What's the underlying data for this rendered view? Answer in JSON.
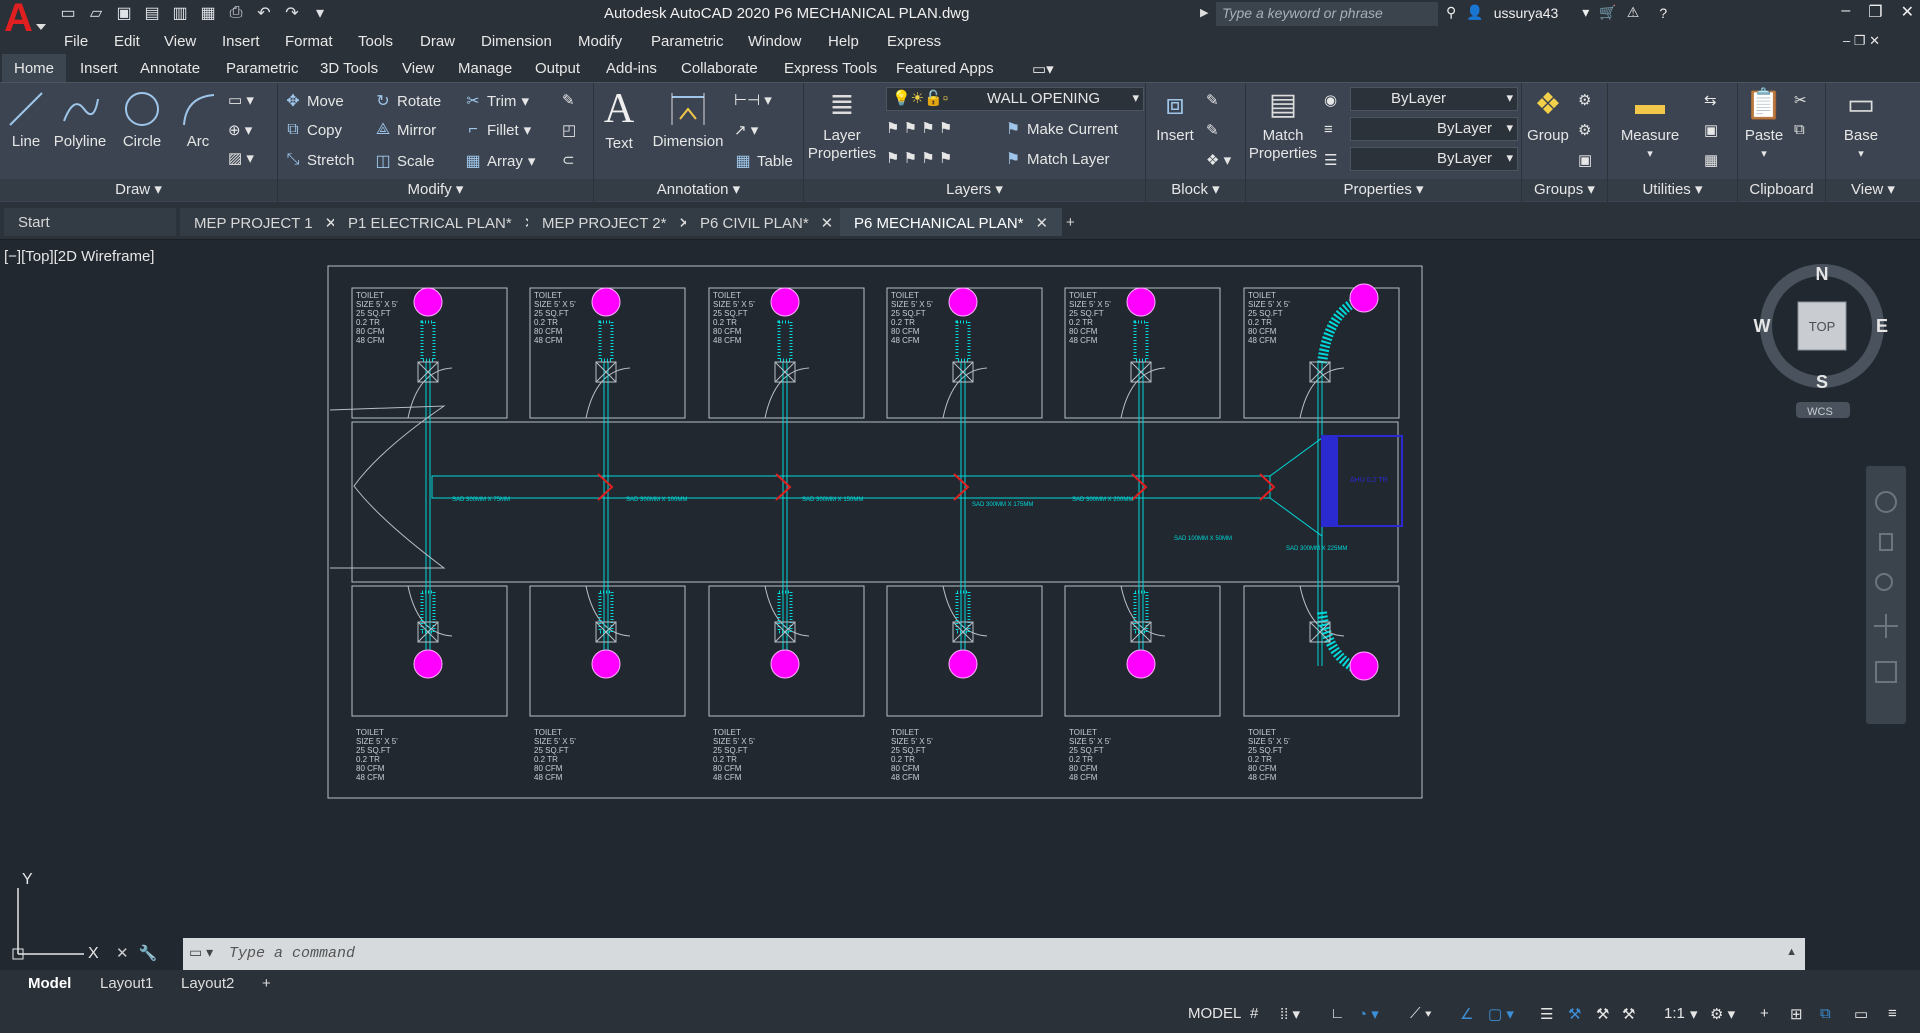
{
  "app": {
    "title": "Autodesk AutoCAD 2020    P6 MECHANICAL PLAN.dwg",
    "search_placeholder": "Type a keyword or phrase",
    "user": "ussurya43"
  },
  "menu": [
    "File",
    "Edit",
    "View",
    "Insert",
    "Format",
    "Tools",
    "Draw",
    "Dimension",
    "Modify",
    "Parametric",
    "Window",
    "Help",
    "Express"
  ],
  "ribbon_tabs": [
    "Home",
    "Insert",
    "Annotate",
    "Parametric",
    "3D Tools",
    "View",
    "Manage",
    "Output",
    "Add-ins",
    "Collaborate",
    "Express Tools",
    "Featured Apps"
  ],
  "draw": {
    "title": "Draw",
    "line": "Line",
    "polyline": "Polyline",
    "circle": "Circle",
    "arc": "Arc"
  },
  "modify": {
    "title": "Modify",
    "move": "Move",
    "rotate": "Rotate",
    "trim": "Trim",
    "copy": "Copy",
    "mirror": "Mirror",
    "fillet": "Fillet",
    "stretch": "Stretch",
    "scale": "Scale",
    "array": "Array"
  },
  "annotation": {
    "title": "Annotation",
    "text": "Text",
    "dimension": "Dimension",
    "table": "Table"
  },
  "layers": {
    "title": "Layers",
    "layer_properties": "Layer Properties",
    "current_layer": "WALL OPENING",
    "make_current": "Make Current",
    "match_layer": "Match Layer"
  },
  "block": {
    "title": "Block",
    "insert": "Insert"
  },
  "properties": {
    "title": "Properties",
    "match_properties": "Match Properties",
    "color": "ByLayer",
    "linetype": "ByLayer",
    "lineweight": "ByLayer"
  },
  "groups": {
    "title": "Groups",
    "group": "Group"
  },
  "utilities": {
    "title": "Utilities",
    "measure": "Measure"
  },
  "clipboard": {
    "title": "Clipboard",
    "paste": "Paste"
  },
  "view_panel": {
    "title": "View",
    "base": "Base"
  },
  "file_tabs": [
    "Start",
    "MEP PROJECT 1",
    "P1 ELECTRICAL PLAN*",
    "MEP PROJECT 2*",
    "P6 CIVIL PLAN*",
    "P6 MECHANICAL PLAN*"
  ],
  "viewport": {
    "label": "[−][Top][2D Wireframe]",
    "room_label_a": [
      "TOILET",
      "SIZE 5' X 5'",
      "25 SQ.FT",
      "0.2 TR",
      "80 CFM",
      "48 CFM"
    ],
    "room_label_b": [
      "TOILET",
      "SIZE 5' X 5'",
      "25 SQ.FT",
      "0.2 TR",
      "80 CFM",
      "48 CFM"
    ],
    "duct_labels": [
      "SAD 300MM X 75MM",
      "SAD 300MM X 100MM",
      "SAD 300MM X 150MM",
      "SAD 300MM X 175MM",
      "SAD 300MM X 200MM",
      "SAD 100MM X 50MM",
      "SAD 300MM X 225MM"
    ],
    "ahu_label": "AHU 0.2 TR"
  },
  "viewcube": {
    "n": "N",
    "s": "S",
    "e": "E",
    "w": "W",
    "top": "TOP",
    "wcs": "WCS"
  },
  "command": {
    "placeholder": "Type  a  command"
  },
  "layout_tabs": [
    "Model",
    "Layout1",
    "Layout2"
  ],
  "status": {
    "model": "MODEL",
    "scale": "1:1"
  },
  "colors": {
    "diffuser": "#ff00ff",
    "duct": "#00d9d9",
    "accent": "#3c8fd6"
  }
}
